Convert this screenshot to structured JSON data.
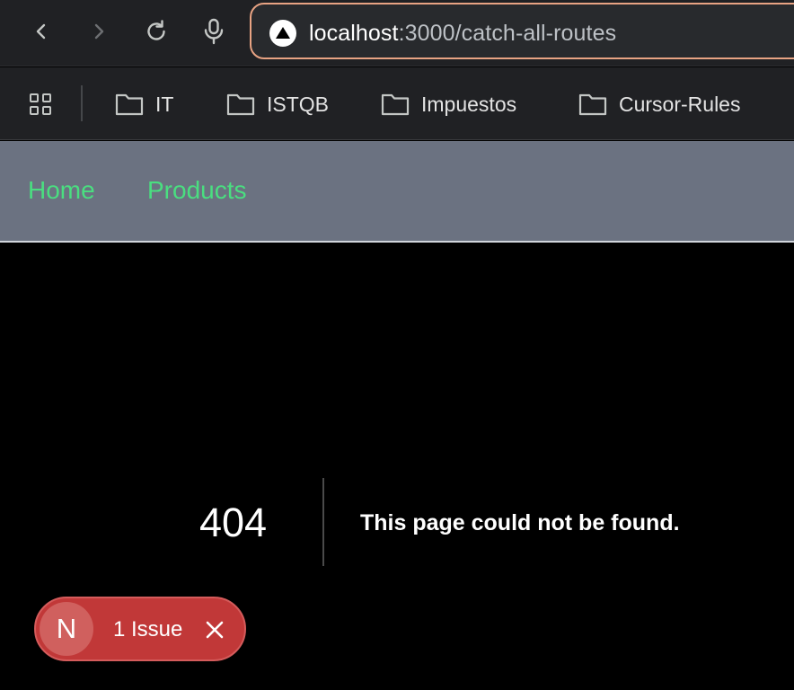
{
  "browser": {
    "url_host": "localhost",
    "url_rest": ":3000/catch-all-routes",
    "back_icon": "chevron-left-icon",
    "forward_icon": "chevron-right-icon",
    "reload_icon": "reload-icon",
    "voice_icon": "microphone-icon",
    "site_icon": "nextjs-triangle-icon"
  },
  "bookmarks": {
    "apps_icon": "apps-grid-icon",
    "items": [
      {
        "label": "IT",
        "icon": "folder-icon"
      },
      {
        "label": "ISTQB",
        "icon": "folder-icon"
      },
      {
        "label": "Impuestos",
        "icon": "folder-icon"
      },
      {
        "label": "Cursor-Rules",
        "icon": "folder-icon"
      }
    ]
  },
  "nav": {
    "links": [
      {
        "label": "Home"
      },
      {
        "label": "Products"
      }
    ]
  },
  "error": {
    "code": "404",
    "message": "This page could not be found."
  },
  "issue_badge": {
    "logo_letter": "N",
    "label": "1 Issue",
    "close_icon": "close-icon"
  },
  "colors": {
    "nav_background": "#6b7281",
    "nav_link": "#4ade80",
    "page_background": "#000000",
    "badge_background": "#c13838",
    "omnibox_border": "#e8a383"
  }
}
